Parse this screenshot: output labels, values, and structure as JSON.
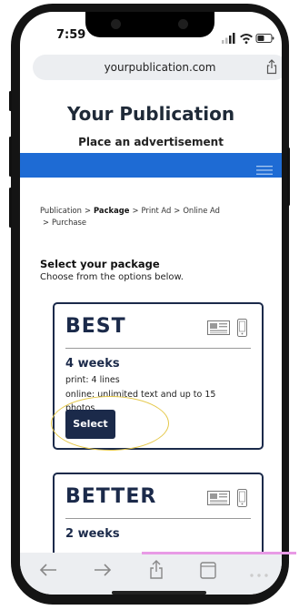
{
  "status_bar": {
    "time": "7:59"
  },
  "browser": {
    "url": "yourpublication.com"
  },
  "header": {
    "title": "Your Publication",
    "subtitle": "Place an advertisement"
  },
  "breadcrumb": {
    "items": [
      "Publication",
      "Package",
      "Print Ad",
      "Online Ad",
      "Purchase"
    ],
    "separator": ">",
    "current": "Package"
  },
  "section": {
    "title": "Select your package",
    "description": "Choose from the options below."
  },
  "packages": [
    {
      "name": "BEST",
      "duration": "4 weeks",
      "print": "print: 4 lines",
      "online_line1": "online: unlimited text and up to 15",
      "online_line2": "photos",
      "select_label": "Select"
    },
    {
      "name": "BETTER",
      "duration": "2 weeks"
    }
  ],
  "colors": {
    "accent_blue": "#1e6bd4",
    "navy": "#1b2a4a",
    "highlight_ring": "#e5c84a",
    "annotation_pink": "#e89ae6"
  },
  "icons": {
    "print_format": "newspaper-icon",
    "online_format": "mobile-phone-icon",
    "menu": "hamburger-menu-icon",
    "share": "share-icon"
  }
}
